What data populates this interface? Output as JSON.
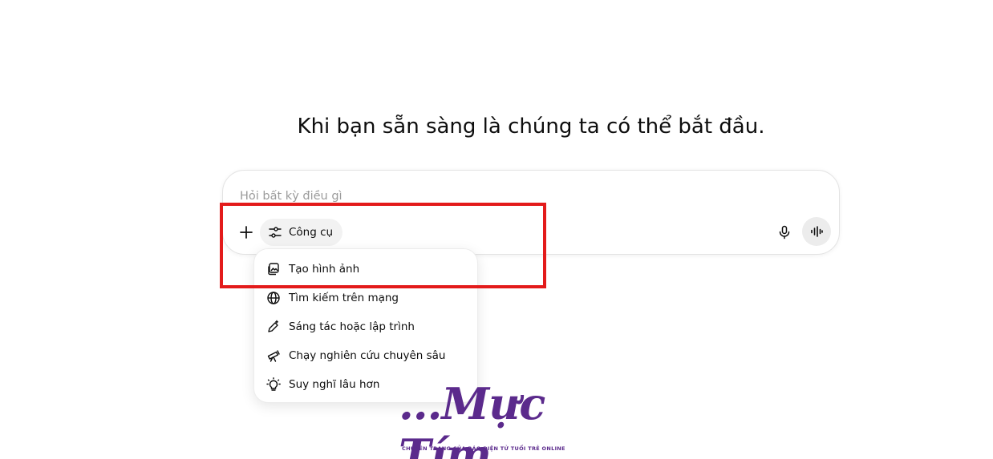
{
  "headline": "Khi bạn sẵn sàng là chúng ta có thể bắt đầu.",
  "composer": {
    "placeholder": "Hỏi bất kỳ điều gì",
    "tools_label": "Công cụ"
  },
  "tools_menu": {
    "items": [
      {
        "label": "Tạo hình ảnh",
        "icon": "image-create-icon"
      },
      {
        "label": "Tìm kiếm trên mạng",
        "icon": "globe-icon"
      },
      {
        "label": "Sáng tác hoặc lập trình",
        "icon": "pen-sparkle-icon"
      },
      {
        "label": "Chạy nghiên cứu chuyên sâu",
        "icon": "telescope-icon"
      },
      {
        "label": "Suy nghĩ lâu hơn",
        "icon": "lightbulb-icon"
      }
    ]
  },
  "watermark": {
    "brand": "...Mực Tím",
    "tagline": "CHUYÊN TRANG CỦA BÁO ĐIỆN TỬ TUỔI TRẺ ONLINE"
  },
  "colors": {
    "highlight": "#e31b1b",
    "watermark": "#5b2a8c"
  }
}
